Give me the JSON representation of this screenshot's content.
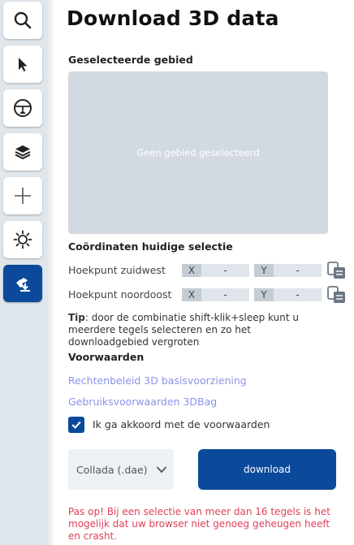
{
  "toolbar": {
    "items": [
      {
        "icon": "search-icon"
      },
      {
        "icon": "cursor-icon"
      },
      {
        "icon": "compass-icon"
      },
      {
        "icon": "layers-icon"
      },
      {
        "icon": "plus-icon"
      },
      {
        "icon": "sun-icon"
      },
      {
        "icon": "download-icon",
        "active": true
      }
    ],
    "active_color": "#0b4a9a"
  },
  "panel": {
    "title": "Download 3D data",
    "selected_area_label": "Geselecteerde gebied",
    "preview_placeholder": "Geen gebied geselecteerd",
    "coords_label": "Coördinaten huidige selectie",
    "coords": [
      {
        "label": "Hoekpunt zuidwest",
        "x_axis": "X",
        "x_value": "-",
        "y_axis": "Y",
        "y_value": "-"
      },
      {
        "label": "Hoekpunt noordoost",
        "x_axis": "X",
        "x_value": "-",
        "y_axis": "Y",
        "y_value": "-"
      }
    ],
    "tip_bold": "Tip",
    "tip_text": ": door de combinatie shift-klik+sleep kunt u meerdere tegels selecteren en zo het downloadgebied vergroten",
    "terms_label": "Voorwaarden",
    "link1": "Rechtenbeleid 3D basisvoorziening",
    "link2": "Gebruiksvoorwaarden 3DBag",
    "agree_label": "Ik ga akkoord met de voorwaarden",
    "agree_checked": true,
    "format_value": "Collada (.dae)",
    "download_label": "download",
    "warning": "Pas op! Bij een selectie van meer dan 16 tegels is het mogelijk dat uw browser niet genoeg geheugen heeft en crasht."
  }
}
